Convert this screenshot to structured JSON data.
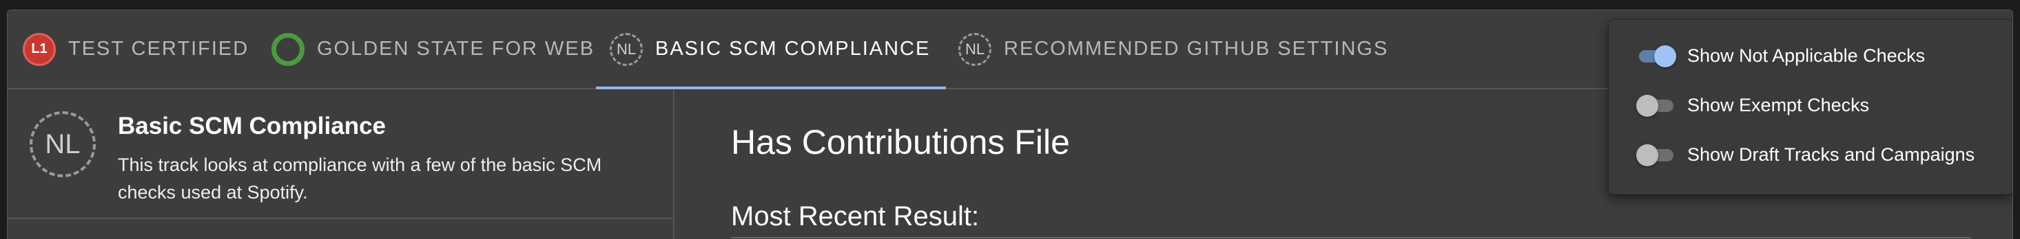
{
  "tabs": [
    {
      "badge": "L1",
      "badge_style": "red",
      "label": "Test Certified",
      "active": false
    },
    {
      "badge": "",
      "badge_style": "ring",
      "label": "Golden State for Web",
      "active": false
    },
    {
      "badge": "NL",
      "badge_style": "dashed",
      "label": "Basic SCM Compliance",
      "active": true
    },
    {
      "badge": "NL",
      "badge_style": "dashed",
      "label": "Recommended GitHub Settings",
      "active": false
    }
  ],
  "track": {
    "badge": "NL",
    "title": "Basic SCM Compliance",
    "description": "This track looks at compliance with a few of the basic SCM checks used at Spotify."
  },
  "check": {
    "title": "Has Contributions File",
    "subtitle": "Most Recent Result:"
  },
  "menu": {
    "items": [
      {
        "label": "Show Not Applicable Checks",
        "checked": true
      },
      {
        "label": "Show Exempt Checks",
        "checked": false
      },
      {
        "label": "Show Draft Tracks and Campaigns",
        "checked": false
      }
    ]
  },
  "colors": {
    "background": "#3d3d3d",
    "accent": "#91b7e8",
    "badge_red": "#c8382f",
    "badge_green": "#4b9a41"
  }
}
